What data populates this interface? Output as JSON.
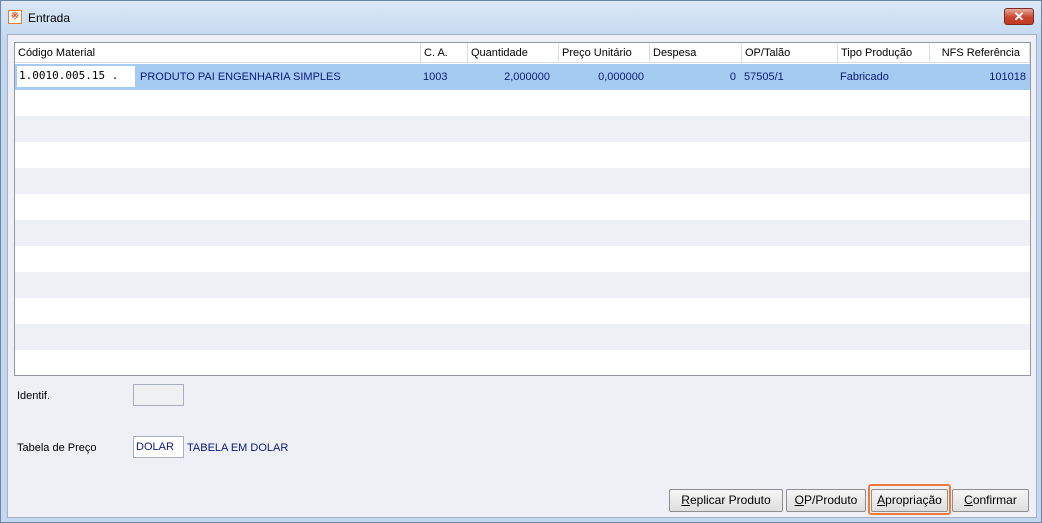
{
  "window": {
    "title": "Entrada",
    "app_icon": "app-logo-icon",
    "close_icon": "close-icon",
    "close_glyph": "✕"
  },
  "grid": {
    "columns": [
      "Código Material",
      "C. A.",
      "Quantidade",
      "Preço Unitário",
      "Despesa",
      "OP/Talão",
      "Tipo Produção",
      "NFS Referência"
    ],
    "rows": [
      {
        "codigo": "1.0010.005.15 .",
        "descricao": "PRODUTO PAI ENGENHARIA SIMPLES",
        "ca": "1003",
        "quantidade": "2,000000",
        "preco": "0,000000",
        "despesa": "0",
        "op_talao": "57505/1",
        "tipo": "Fabricado",
        "nfs": "101018"
      }
    ],
    "empty_row_count": 11,
    "colors": {
      "selected": "#a6cbf1",
      "alt": "#eef0f6",
      "text": "#0a1a7a"
    }
  },
  "form": {
    "identif_label": "Identif.",
    "identif_value": "",
    "tabela_label": "Tabela de Preço",
    "tabela_value": "DOLAR",
    "tabela_desc": "TABELA EM DOLAR"
  },
  "buttons": {
    "replicar": {
      "first": "R",
      "rest": "eplicar Produto"
    },
    "op_produto": {
      "first": "O",
      "rest": "P/Produto"
    },
    "apropriacao": {
      "first": "A",
      "rest": "propriação"
    },
    "confirmar": {
      "first": "C",
      "rest": "onfirmar"
    },
    "highlight_color": "#ec7b3c"
  }
}
